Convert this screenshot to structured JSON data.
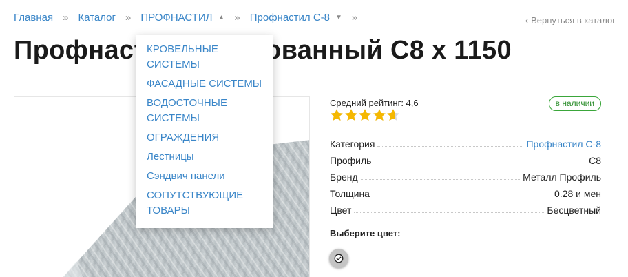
{
  "breadcrumbs": {
    "items": [
      "Главная",
      "Каталог",
      "ПРОФНАСТИЛ",
      "Профнастил С-8"
    ],
    "separator": "»"
  },
  "back_link": "Вернуться в каталог",
  "title": "Профнастил оцинкованный С8 х 1150",
  "dropdown": {
    "items": [
      "КРОВЕЛЬНЫЕ СИСТЕМЫ",
      "ФАСАДНЫЕ СИСТЕМЫ",
      "ВОДОСТОЧНЫЕ СИСТЕМЫ",
      "ОГРАЖДЕНИЯ",
      "Лестницы",
      "Сэндвич панели",
      "СОПУТСТВУЮЩИЕ ТОВАРЫ"
    ]
  },
  "rating": {
    "label": "Средний рейтинг: 4,6",
    "value": 4.6,
    "max": 5
  },
  "stock_badge": "в наличии",
  "properties": [
    {
      "name": "Категория",
      "value": "Профнастил С-8"
    },
    {
      "name": "Профиль",
      "value": "С8"
    },
    {
      "name": "Бренд",
      "value": "Металл Профиль"
    },
    {
      "name": "Толщина",
      "value": "0.28 и мен"
    },
    {
      "name": "Цвет",
      "value": "Бесцветный"
    }
  ],
  "choose_color_label": "Выберите цвет:",
  "colors": {
    "link": "#3a86c8",
    "star": "#f5b800",
    "badge": "#3aa63a",
    "swatch": "#c4c4c4"
  }
}
